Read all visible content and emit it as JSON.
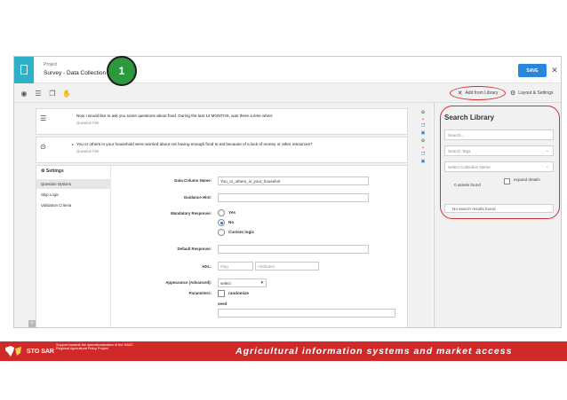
{
  "header": {
    "project_label": "Project",
    "project_name": "Survey - Data Collection",
    "step_badge": "1",
    "save_label": "SAVE",
    "close_glyph": "✕"
  },
  "toolbar": {
    "add_from_library": "Add from Library",
    "layout_settings": "Layout & Settings"
  },
  "questions": [
    {
      "text": "Now I would like to ask you some questions about food. During the last 12 MONTHS, was there a time when:",
      "hint": "Question hint"
    },
    {
      "text": "You or others in your household were worried about not having enough food to eat because of a lack of money or other resources?",
      "hint": "Question hint"
    }
  ],
  "settings": {
    "title": "Settings",
    "nav": [
      "Question Options",
      "Skip Logic",
      "Validation Criteria"
    ],
    "data_column_name_label": "Data Column Name:",
    "data_column_name_value": "You_or_others_in_your_househol",
    "guidance_hint_label": "Guidance Hint:",
    "mandatory_label": "Mandatory Response:",
    "mandatory_options": [
      "Yes",
      "No",
      "Custom logic"
    ],
    "mandatory_selected": "No",
    "default_response_label": "Default Response:",
    "hxl_label": "HXL:",
    "hxl_tag_placeholder": "#tag",
    "hxl_attr_placeholder": "Attributes",
    "appearance_label": "Appearance (Advanced):",
    "appearance_value": "select",
    "parameters_label": "Parameters:",
    "randomize_label": "randomize",
    "seed_label": "seed"
  },
  "library": {
    "title": "Search Library",
    "search_placeholder": "Search...",
    "tags_placeholder": "Search Tags",
    "collection_placeholder": "Select Collection Name",
    "assets_found": "0 assets found",
    "expand_details": "expand details",
    "no_results": "No search results found"
  },
  "footer": {
    "logo_text": "STO SAR",
    "tagline": "Support towards the operationalization of the SADC Regional Agricultural Policy Project",
    "title": "Agricultural information systems and market access"
  },
  "colors": {
    "accent_teal": "#2db0c8",
    "save_blue": "#2a86db",
    "badge_green": "#2c9a3c",
    "highlight_red": "#d2302f",
    "banner_red": "#cf2a27"
  }
}
